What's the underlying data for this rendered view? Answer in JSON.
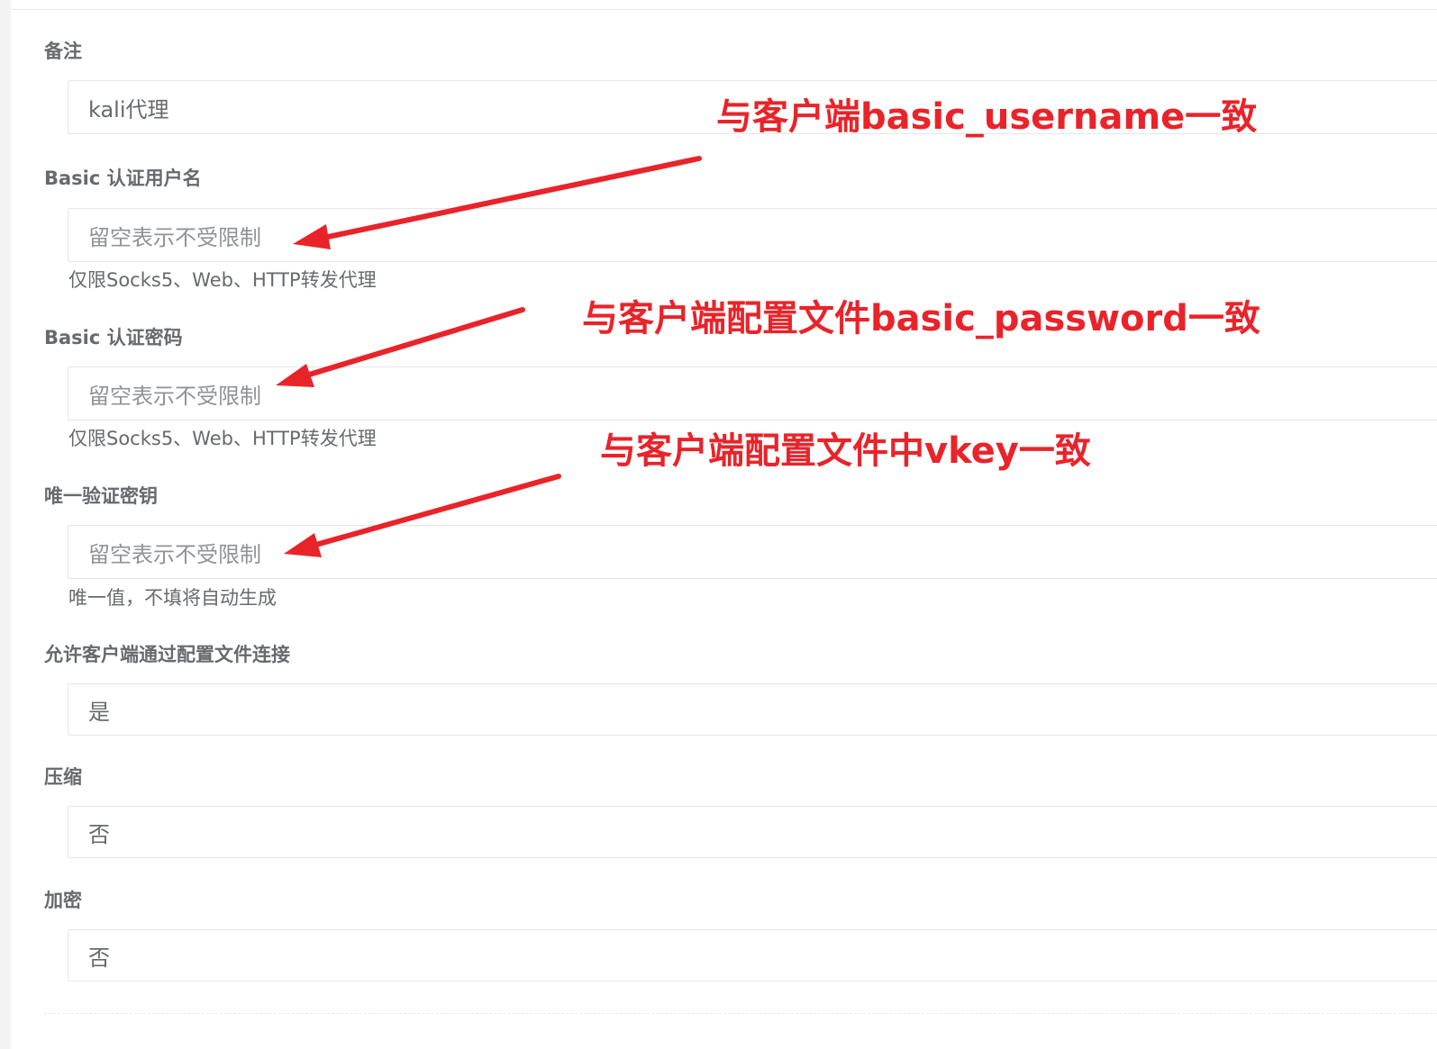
{
  "form": {
    "remark": {
      "label": "备注",
      "value": "kali代理"
    },
    "basic_username": {
      "label": "Basic 认证用户名",
      "placeholder": "留空表示不受限制",
      "help": "仅限Socks5、Web、HTTP转发代理"
    },
    "basic_password": {
      "label": "Basic 认证密码",
      "placeholder": "留空表示不受限制",
      "help": "仅限Socks5、Web、HTTP转发代理"
    },
    "vkey": {
      "label": "唯一验证密钥",
      "placeholder": "留空表示不受限制",
      "help": "唯一值，不填将自动生成"
    },
    "config_conn": {
      "label": "允许客户端通过配置文件连接",
      "value": "是"
    },
    "compress": {
      "label": "压缩",
      "value": "否"
    },
    "crypt": {
      "label": "加密",
      "value": "否"
    }
  },
  "annotations": {
    "username_note": "与客户端basic_username一致",
    "password_note": "与客户端配置文件basic_password一致",
    "vkey_note": "与客户端配置文件中vkey一致",
    "color": "#e8242a"
  }
}
